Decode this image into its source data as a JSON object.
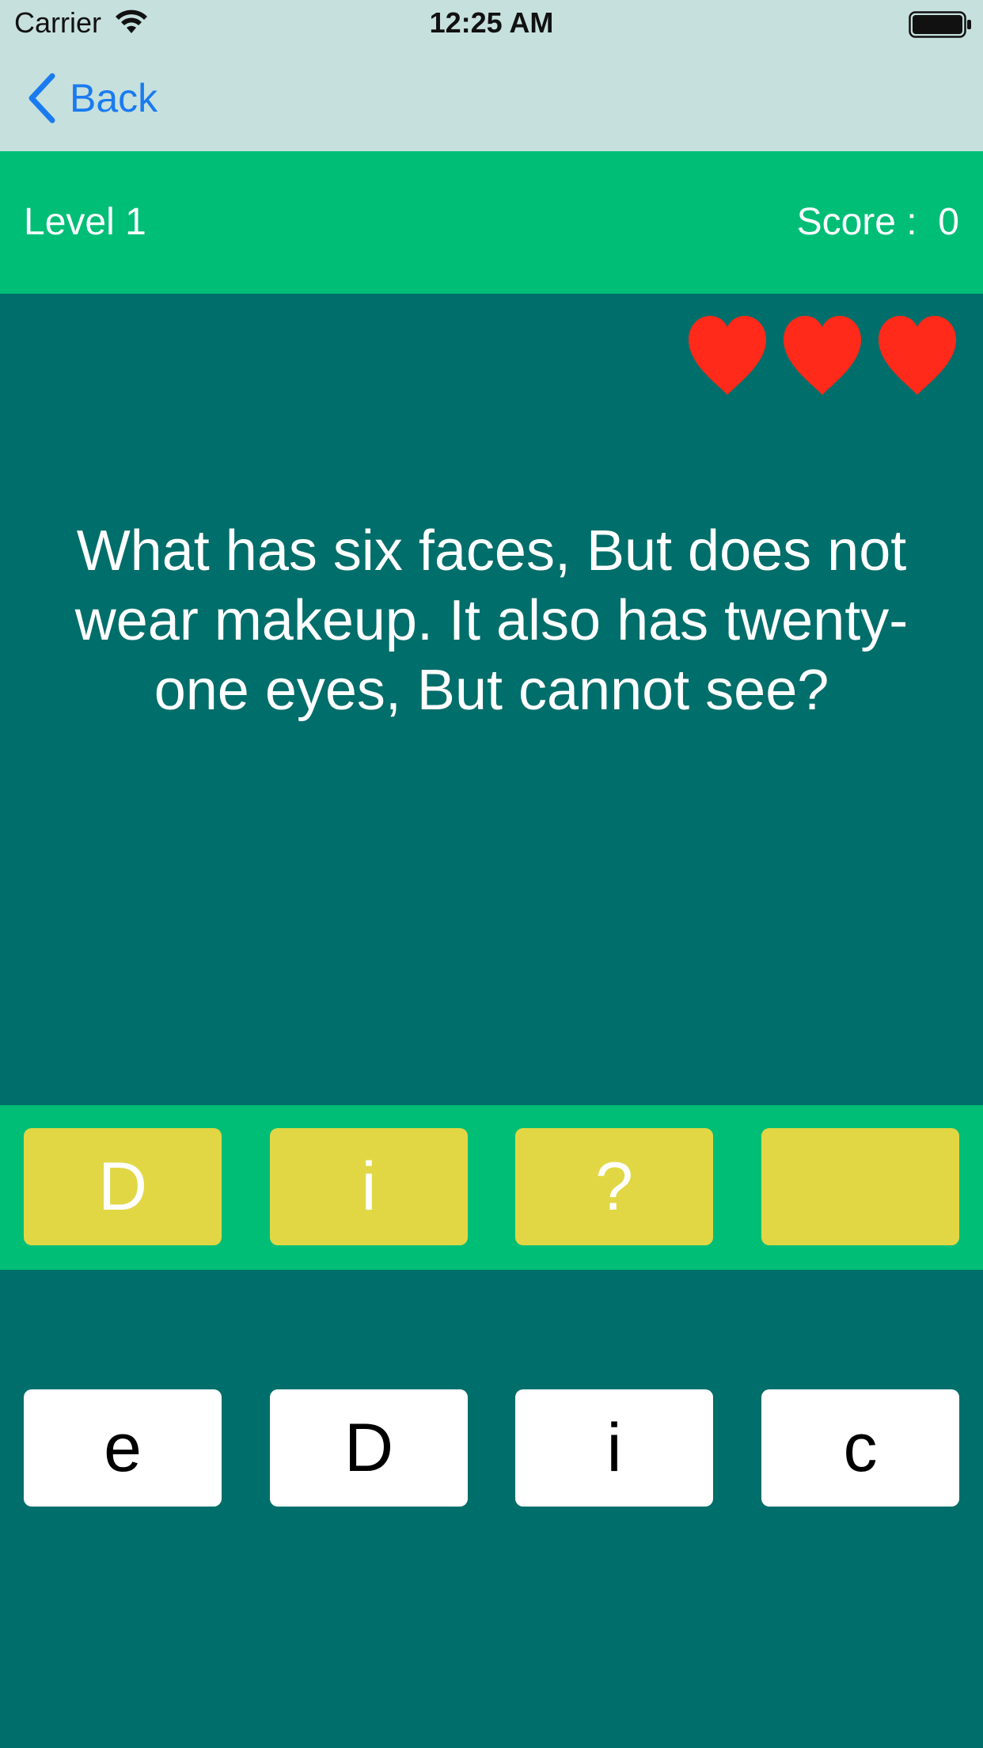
{
  "status_bar": {
    "carrier": "Carrier",
    "time": "12:25 AM",
    "wifi_icon": "wifi-icon",
    "battery_icon": "battery-icon"
  },
  "nav": {
    "back_label": "Back",
    "back_icon": "chevron-left-icon",
    "accent_color": "#1a7bf0"
  },
  "level_bar": {
    "level": "Level 1",
    "score": "Score :  0"
  },
  "lives": {
    "count": 3,
    "icon": "heart-icon",
    "color": "#ff2a1a"
  },
  "question": "What has six faces, But does not wear makeup. It also has twenty-one eyes, But cannot see?",
  "answer_slots": [
    "D",
    "i",
    "?",
    ""
  ],
  "letter_tiles": [
    "e",
    "D",
    "i",
    "c"
  ],
  "colors": {
    "background": "#006e6a",
    "top_bar": "#c6e0dd",
    "green_bar": "#00be76",
    "slot": "#e1d745",
    "tile": "#ffffff"
  }
}
